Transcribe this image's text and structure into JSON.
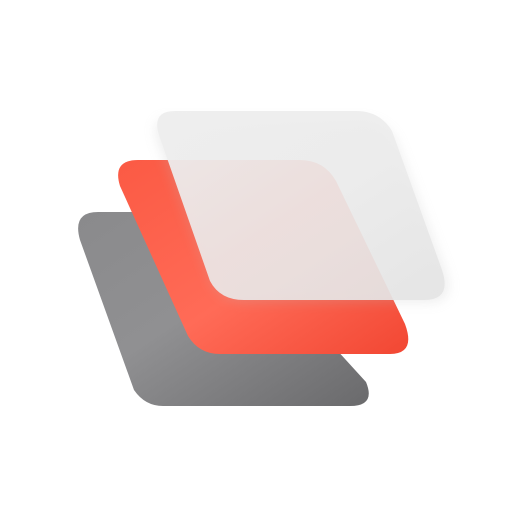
{
  "logo": {
    "name": "layers-icon",
    "colors": {
      "back_layer": "#7a7a7c",
      "middle_layer": "#fb5a44",
      "front_layer": "#e9e9e9"
    }
  }
}
